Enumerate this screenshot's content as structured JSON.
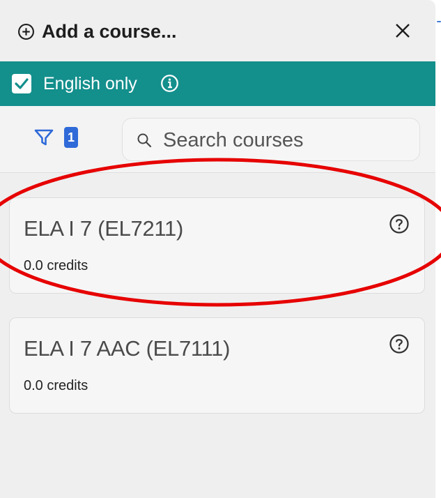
{
  "header": {
    "title": "Add a course...",
    "add_icon": "plus-circle-icon",
    "close_icon": "close-icon"
  },
  "lang_filter": {
    "label": "English only",
    "checked": true,
    "info_icon": "info-icon"
  },
  "filter": {
    "icon": "funnel-icon",
    "count": "1"
  },
  "search": {
    "placeholder": "Search courses",
    "value": ""
  },
  "courses": [
    {
      "name": "ELA I 7 (EL7211)",
      "credits": "0.0 credits",
      "help_icon": "question-circle-icon"
    },
    {
      "name": "ELA I 7 AAC (EL7111)",
      "credits": "0.0 credits",
      "help_icon": "question-circle-icon"
    }
  ],
  "colors": {
    "accent_teal": "#138f8c",
    "badge_blue": "#2f6ad8",
    "annotation_red": "#e60000",
    "panel_bg": "#efefef"
  }
}
